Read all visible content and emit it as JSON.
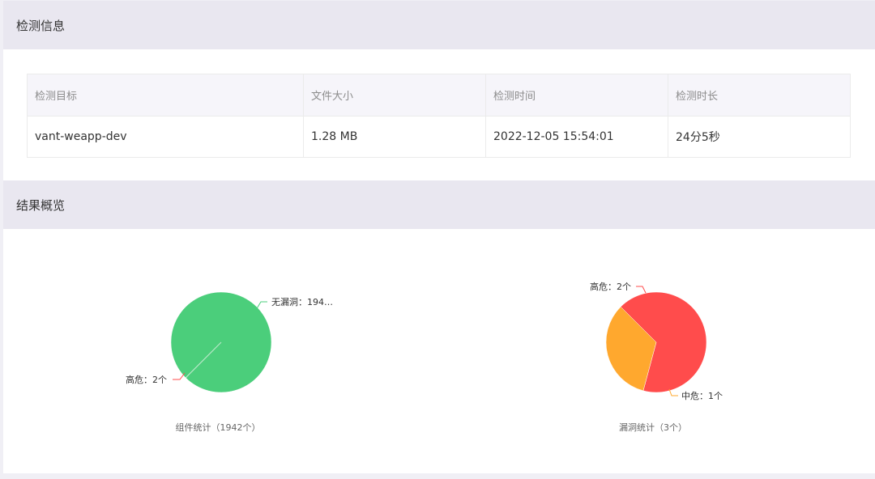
{
  "detect_section": {
    "title": "检测信息",
    "table": {
      "headers": [
        "检测目标",
        "文件大小",
        "检测时间",
        "检测时长"
      ],
      "row": [
        "vant-weapp-dev",
        "1.28 MB",
        "2022-12-05 15:54:01",
        "24分5秒"
      ]
    }
  },
  "result_section": {
    "title": "结果概览"
  },
  "chart_data": [
    {
      "type": "pie",
      "title": "组件统计（1942个）",
      "labels": [
        "无漏洞",
        "高危"
      ],
      "values": [
        1940,
        2
      ],
      "slice_labels": [
        "无漏洞：194…",
        "高危：2个"
      ],
      "colors": [
        "#4bce7b",
        "#ff4c4c"
      ]
    },
    {
      "type": "pie",
      "title": "漏洞统计（3个）",
      "labels": [
        "高危",
        "中危"
      ],
      "values": [
        2,
        1
      ],
      "slice_labels": [
        "高危：2个",
        "中危：1个"
      ],
      "colors": [
        "#ff4c4c",
        "#ffa82e"
      ]
    }
  ]
}
